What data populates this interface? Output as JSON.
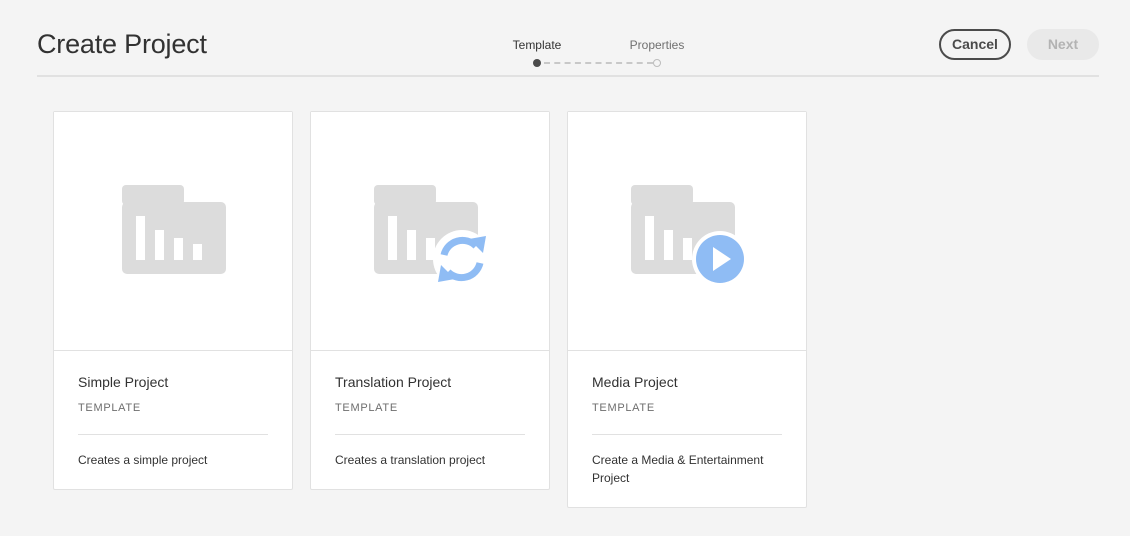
{
  "header": {
    "title": "Create Project",
    "cancel_label": "Cancel",
    "next_label": "Next"
  },
  "wizard": {
    "steps": [
      {
        "label": "Template",
        "state": "active"
      },
      {
        "label": "Properties",
        "state": "inactive"
      }
    ]
  },
  "cards": [
    {
      "title": "Simple Project",
      "subtitle": "TEMPLATE",
      "description": "Creates a simple project",
      "icon": "folder-chart-icon"
    },
    {
      "title": "Translation Project",
      "subtitle": "TEMPLATE",
      "description": "Creates a translation project",
      "icon": "folder-chart-sync-icon"
    },
    {
      "title": "Media Project",
      "subtitle": "TEMPLATE",
      "description": "Create a Media & Entertainment Project",
      "icon": "folder-chart-play-icon"
    }
  ],
  "colors": {
    "background": "#f4f4f4",
    "card": "#ffffff",
    "folder_gray": "#dcdcdc",
    "accent_blue": "#8fbcf4",
    "disabled_button": "#e9e9e9"
  }
}
